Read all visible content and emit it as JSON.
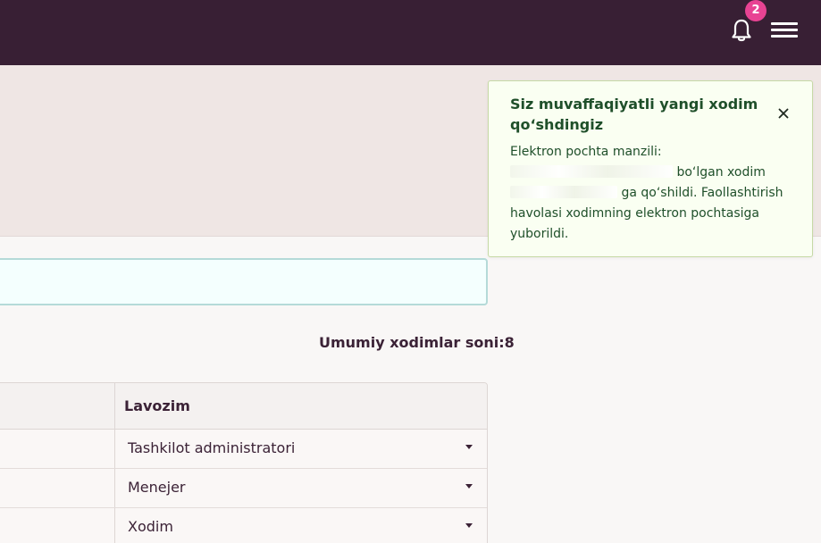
{
  "header": {
    "notification_count": "2",
    "notification_icon": "bell-icon",
    "menu_icon": "hamburger-menu-icon",
    "background": "#381f34"
  },
  "summary": {
    "total_label": "Umumiy xodimlar soni:8"
  },
  "table": {
    "columns": [
      "Lavozim"
    ],
    "rows": [
      {
        "role": "Tashkilot administratori"
      },
      {
        "role": "Menejer"
      },
      {
        "role": "Xodim"
      }
    ]
  },
  "toast": {
    "title": "Siz muvaffaqiyatli yangi xodim qo‘shdingiz",
    "body_prefix": "Elektron pochta manzili:",
    "body_part2": "bo‘lgan xodim",
    "body_part3": "ga qo‘shildi. Faollashtirish havolasi xodimning elektron pochtasiga yuborildi.",
    "accent": "#1f4f2a",
    "background": "#fafff2"
  }
}
